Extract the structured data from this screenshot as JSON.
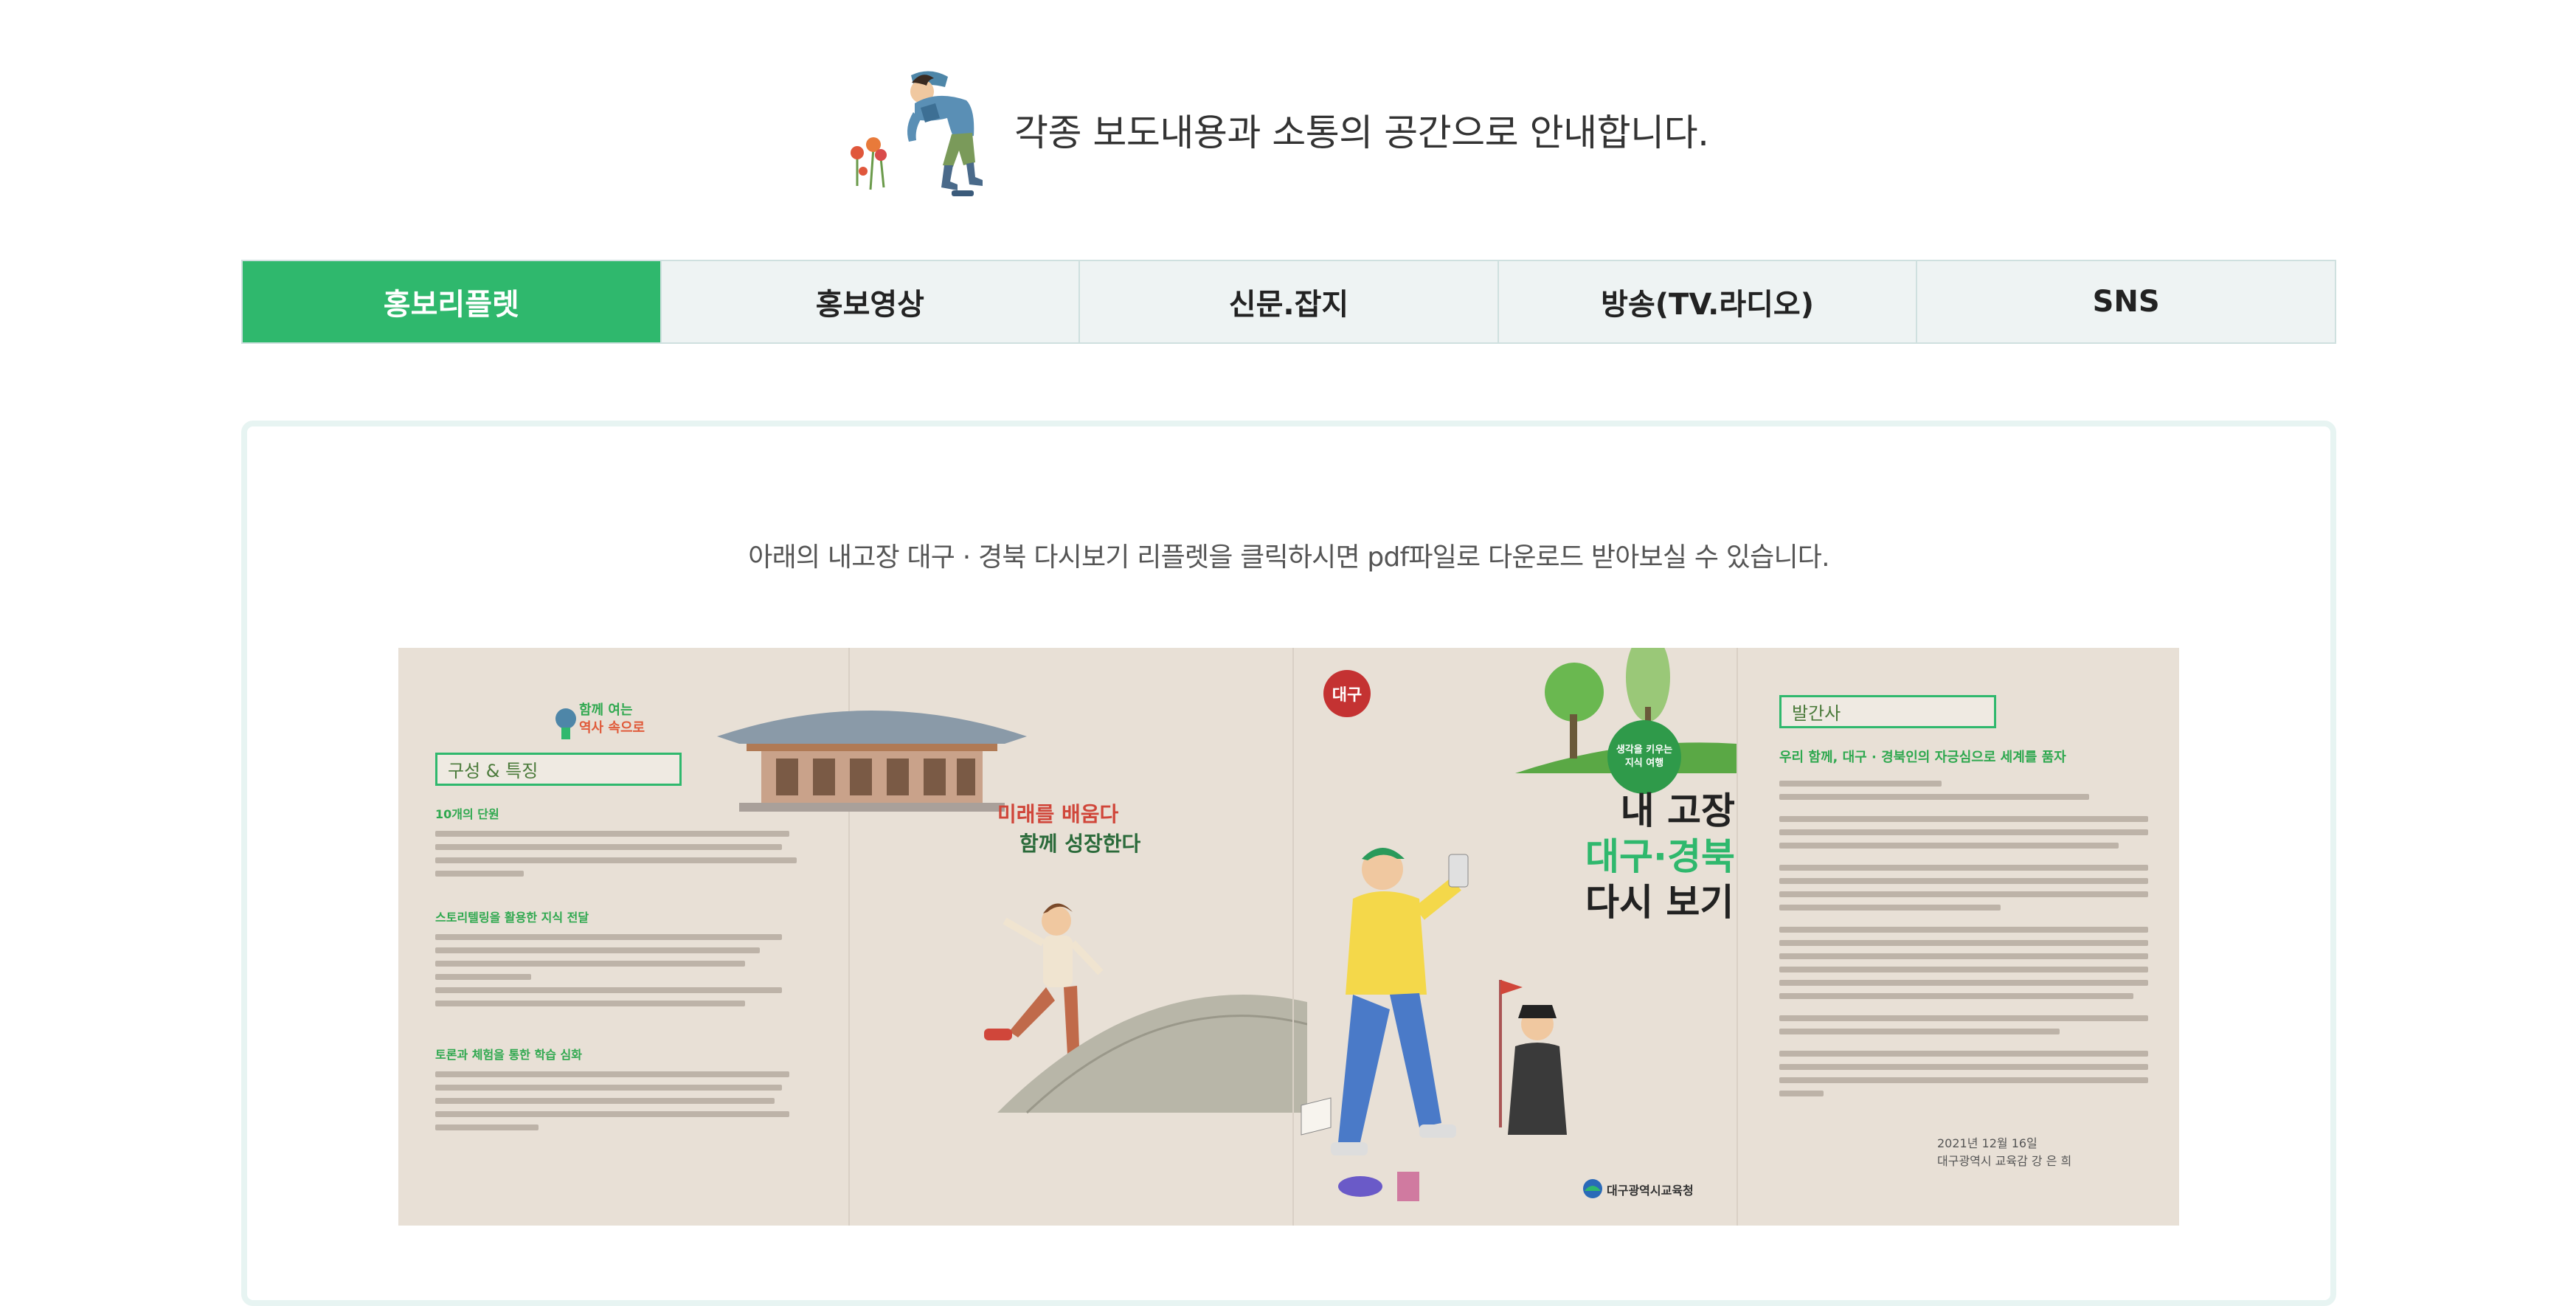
{
  "intro": {
    "headline": "각종 보도내용과 소통의 공간으로 안내합니다.",
    "mascot_icon": "hiker-illustration-icon"
  },
  "tabs": [
    {
      "label": "홍보리플렛",
      "active": true
    },
    {
      "label": "홍보영상",
      "active": false
    },
    {
      "label": "신문.잡지",
      "active": false
    },
    {
      "label": "방송(TV.라디오)",
      "active": false
    },
    {
      "label": "SNS",
      "active": false
    }
  ],
  "content": {
    "notice": "아래의 내고장 대구 · 경북 다시보기 리플렛을 클릭하시면 pdf파일로 다운로드 받아보실 수 있습니다."
  },
  "leaflet": {
    "panel1": {
      "logo_text": "함께 여는 역사 속으로",
      "section_title": "구성 & 특징",
      "items": [
        {
          "heading": "10개의 단원"
        },
        {
          "heading": "스토리텔링을 활용한 지식 전달"
        },
        {
          "heading": "토론과 체험을 통한 학습 심화"
        }
      ]
    },
    "panel2": {
      "slogan_line1": "미래를 배움다",
      "slogan_line2": "함께 성장한다"
    },
    "panel3": {
      "badge": "대구",
      "tag": "생각을 키우는 지식 여행",
      "title_line1": "내 고장",
      "title_line2": "대구·경북",
      "title_line3": "다시 보기",
      "publisher": "대구광역시교육청"
    },
    "panel4": {
      "section_title": "발간사",
      "heading": "우리 함께, 대구 · 경북인의 자긍심으로 세계를 품자",
      "date": "2021년 12월 16일",
      "signer": "대구광역시 교육감 강 은 희"
    }
  },
  "colors": {
    "accent_green": "#2fb86d",
    "tab_inactive_bg": "#eef3f3",
    "leaflet_bg": "#e8e0d6"
  }
}
